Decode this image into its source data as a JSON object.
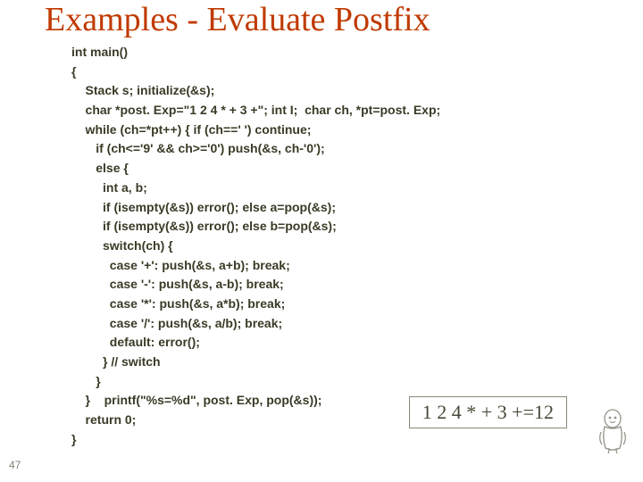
{
  "title": "Examples - Evaluate Postfix",
  "code": "int main()\n{\n    Stack s; initialize(&s);\n    char *post. Exp=\"1 2 4 * + 3 +\"; int I;  char ch, *pt=post. Exp;\n    while (ch=*pt++) { if (ch==' ') continue;\n       if (ch<='9' && ch>='0') push(&s, ch-'0');\n       else {\n         int a, b;\n         if (isempty(&s)) error(); else a=pop(&s);\n         if (isempty(&s)) error(); else b=pop(&s);\n         switch(ch) {\n           case '+': push(&s, a+b); break;\n           case '-': push(&s, a-b); break;\n           case '*': push(&s, a*b); break;\n           case '/': push(&s, a/b); break;\n           default: error();\n         } // switch\n       }\n    }    printf(\"%s=%d\", post. Exp, pop(&s));\n    return 0;\n}",
  "slide_number": "47",
  "result": "1 2 4 * + 3 +=12"
}
